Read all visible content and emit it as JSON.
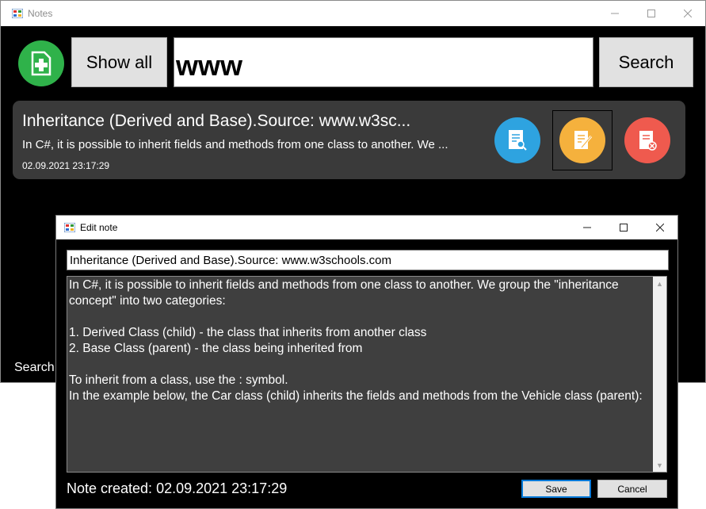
{
  "main": {
    "title": "Notes",
    "show_all_label": "Show all",
    "search_value": "www",
    "search_label": "Search",
    "bottom_label": "Search",
    "note": {
      "title": "Inheritance (Derived and Base).Source: www.w3sc...",
      "body": "In C#, it is possible to inherit fields and methods from one class to another. We ...",
      "date": "02.09.2021 23:17:29"
    },
    "colors": {
      "add": "#2fb24a",
      "view": "#2ea3e0",
      "edit": "#f5b13d",
      "delete": "#ef5a4e"
    },
    "icons": {
      "add": "add-note-icon",
      "view": "view-note-icon",
      "edit": "edit-note-icon",
      "delete": "delete-note-icon"
    }
  },
  "dialog": {
    "title": "Edit note",
    "note_title": "Inheritance (Derived and Base).Source: www.w3schools.com",
    "note_body": "In C#, it is possible to inherit fields and methods from one class to another. We group the \"inheritance concept\" into two categories:\n\n1. Derived Class (child) - the class that inherits from another class\n2. Base Class (parent) - the class being inherited from\n\nTo inherit from a class, use the : symbol.\nIn the example below, the Car class (child) inherits the fields and methods from the Vehicle class (parent):",
    "created": "Note created: 02.09.2021 23:17:29",
    "save_label": "Save",
    "cancel_label": "Cancel"
  }
}
